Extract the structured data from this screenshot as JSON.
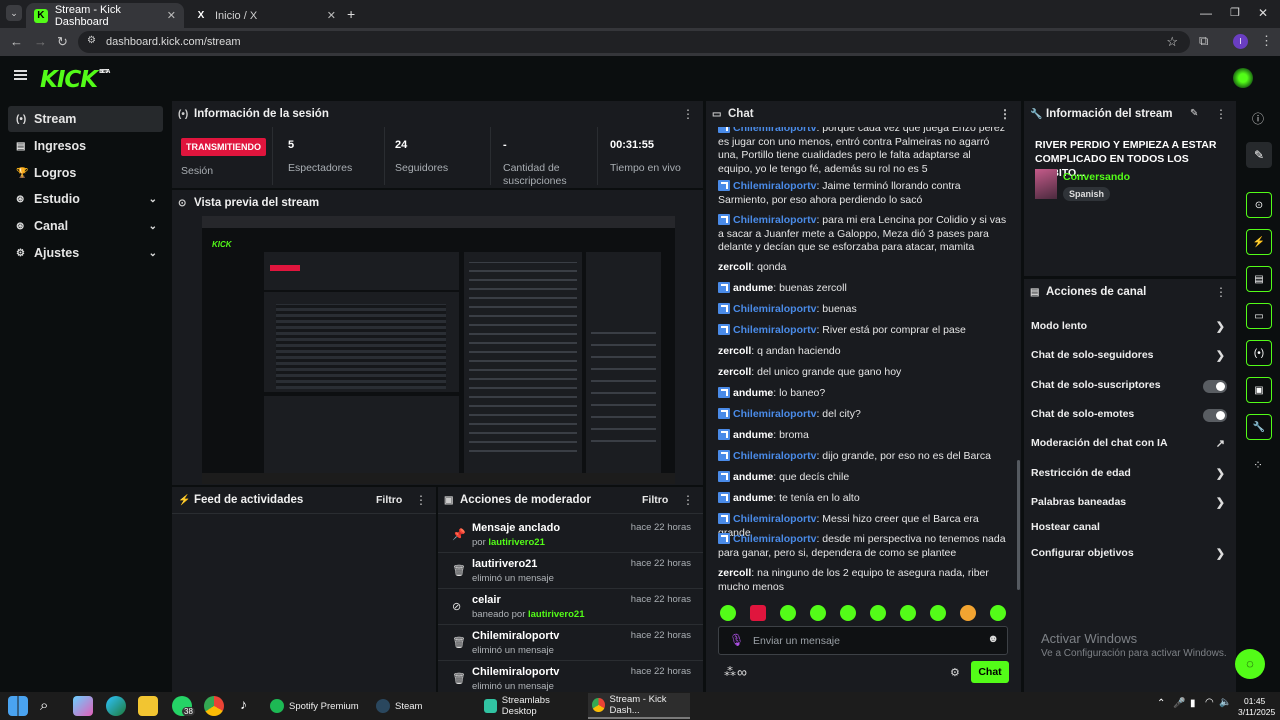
{
  "browser": {
    "tabs": [
      {
        "title": "Stream - Kick Dashboard",
        "icon": "K"
      },
      {
        "title": "Inicio / X",
        "icon": "X"
      }
    ],
    "url": "dashboard.kick.com/stream",
    "profile_initial": "I"
  },
  "brand": {
    "logo": "KICK",
    "logo_badge": "BETA",
    "accent": "#53fc18"
  },
  "sidebar": {
    "items": [
      {
        "label": "Stream",
        "icon": "(•)"
      },
      {
        "label": "Ingresos",
        "icon": "▤"
      },
      {
        "label": "Logros",
        "icon": "🏆"
      },
      {
        "label": "Estudio",
        "icon": "⊛"
      },
      {
        "label": "Canal",
        "icon": "⊛"
      },
      {
        "label": "Ajustes",
        "icon": "⚙"
      }
    ]
  },
  "session": {
    "title": "Información de la sesión",
    "live_badge": "TRANSMITIENDO",
    "live_label": "Sesión",
    "stats": [
      {
        "value": "5",
        "label": "Espectadores"
      },
      {
        "value": "24",
        "label": "Seguidores"
      },
      {
        "value": "-",
        "label": "Cantidad de suscripciones"
      },
      {
        "value": "00:31:55",
        "label": "Tiempo en vivo"
      }
    ]
  },
  "preview": {
    "title": "Vista previa del stream"
  },
  "activity": {
    "title": "Feed de actividades",
    "filter": "Filtro"
  },
  "moderator": {
    "title": "Acciones de moderador",
    "filter": "Filtro",
    "rows": [
      {
        "icon": "pin-icon",
        "title": "Mensaje anclado",
        "sub": "por",
        "user": "lautirivero21",
        "time": "hace 22 horas"
      },
      {
        "icon": "trash-icon",
        "title": "lautirivero21",
        "sub": "eliminó un mensaje",
        "user": "",
        "time": "hace 22 horas"
      },
      {
        "icon": "ban-icon",
        "title": "celair",
        "sub": "baneado por",
        "user": "lautirivero21",
        "time": "hace 22 horas"
      },
      {
        "icon": "trash-icon",
        "title": "Chilemiraloportv",
        "sub": "eliminó un mensaje",
        "user": "",
        "time": "hace 22 horas"
      },
      {
        "icon": "trash-icon",
        "title": "Chilemiraloportv",
        "sub": "eliminó un mensaje",
        "user": "",
        "time": "hace 22 horas"
      }
    ]
  },
  "chat": {
    "title": "Chat",
    "placeholder": "Enviar un mensaje",
    "send": "Chat",
    "messages": [
      {
        "user": "Chilemiraloportv",
        "color": "#4a8be8",
        "badge": true,
        "text": "porque cada vez que juega Enzo perez es jugar con uno menos, entró contra Palmeiras no agarró una, Portillo tiene cualidades pero le falta adaptarse al equipo, yo le tengo fé, además su rol no es 5"
      },
      {
        "user": "Chilemiraloportv",
        "color": "#4a8be8",
        "badge": true,
        "text": "Jaime terminó llorando contra Sarmiento, por eso ahora perdiendo lo sacó"
      },
      {
        "user": "Chilemiraloportv",
        "color": "#4a8be8",
        "badge": true,
        "text": "para mi era Lencina por Colidio y si vas a sacar a Juanfer mete a Galoppo, Meza dió 3 pases para delante y decían que se esforzaba para atacar, mamita"
      },
      {
        "user": "zercoll",
        "color": "#ffffff",
        "badge": false,
        "text": "qonda"
      },
      {
        "user": "andume",
        "color": "#ffffff",
        "badge": true,
        "text": "buenas zercoll"
      },
      {
        "user": "Chilemiraloportv",
        "color": "#4a8be8",
        "badge": true,
        "text": "buenas"
      },
      {
        "user": "Chilemiraloportv",
        "color": "#4a8be8",
        "badge": true,
        "text": "River está por comprar el pase"
      },
      {
        "user": "zercoll",
        "color": "#ffffff",
        "badge": false,
        "text": "q andan haciendo"
      },
      {
        "user": "zercoll",
        "color": "#ffffff",
        "badge": false,
        "text": "del unico grande que gano hoy"
      },
      {
        "user": "andume",
        "color": "#ffffff",
        "badge": true,
        "text": "lo baneo?"
      },
      {
        "user": "Chilemiraloportv",
        "color": "#4a8be8",
        "badge": true,
        "text": "del city?"
      },
      {
        "user": "andume",
        "color": "#ffffff",
        "badge": true,
        "text": "broma"
      },
      {
        "user": "Chilemiraloportv",
        "color": "#4a8be8",
        "badge": true,
        "text": "dijo grande, por eso no es del Barca"
      },
      {
        "user": "andume",
        "color": "#ffffff",
        "badge": true,
        "text": "que decís chile"
      },
      {
        "user": "andume",
        "color": "#ffffff",
        "badge": true,
        "text": "te tenía en lo alto"
      },
      {
        "user": "Chilemiraloportv",
        "color": "#4a8be8",
        "badge": true,
        "text": "Messi hizo creer que el Barca era grande"
      },
      {
        "user": "Chilemiraloportv",
        "color": "#4a8be8",
        "badge": true,
        "text": "desde mi perspectiva no tenemos nada para ganar, pero si, dependera de como se plantee"
      },
      {
        "user": "zercoll",
        "color": "#ffffff",
        "badge": false,
        "text": "na ninguno de los 2 equipo te asegura nada, riber mucho menos"
      }
    ]
  },
  "stream_info": {
    "title": "Información del stream",
    "stream_title": "RIVER PERDIO Y EMPIEZA A ESTAR COMPLICADO EN TODOS LOS AMBITO...",
    "category": "Conversando",
    "language": "Spanish"
  },
  "channel_actions": {
    "title": "Acciones de canal",
    "items": [
      {
        "label": "Modo lento",
        "control": "chevron"
      },
      {
        "label": "Chat de solo-seguidores",
        "control": "chevron"
      },
      {
        "label": "Chat de solo-suscriptores",
        "control": "toggle"
      },
      {
        "label": "Chat de solo-emotes",
        "control": "toggle"
      },
      {
        "label": "Moderación del chat con IA",
        "control": "external"
      },
      {
        "label": "Restricción de edad",
        "control": "chevron"
      },
      {
        "label": "Palabras baneadas",
        "control": "chevron"
      },
      {
        "label": "Hostear canal",
        "control": "none"
      },
      {
        "label": "Configurar objetivos",
        "control": "chevron"
      }
    ]
  },
  "watermark": {
    "line1": "Activar Windows",
    "line2": "Ve a Configuración para activar Windows."
  },
  "taskbar": {
    "apps": [
      {
        "label": "Spotify Premium",
        "color": "#1db954"
      },
      {
        "label": "Steam",
        "color": "#1b2838"
      },
      {
        "label": "Streamlabs Desktop",
        "color": "#31c3a2"
      },
      {
        "label": "Stream - Kick Dash...",
        "color": "#e34133"
      }
    ],
    "badge": "38",
    "time": "01:45",
    "date": "3/11/2025"
  }
}
